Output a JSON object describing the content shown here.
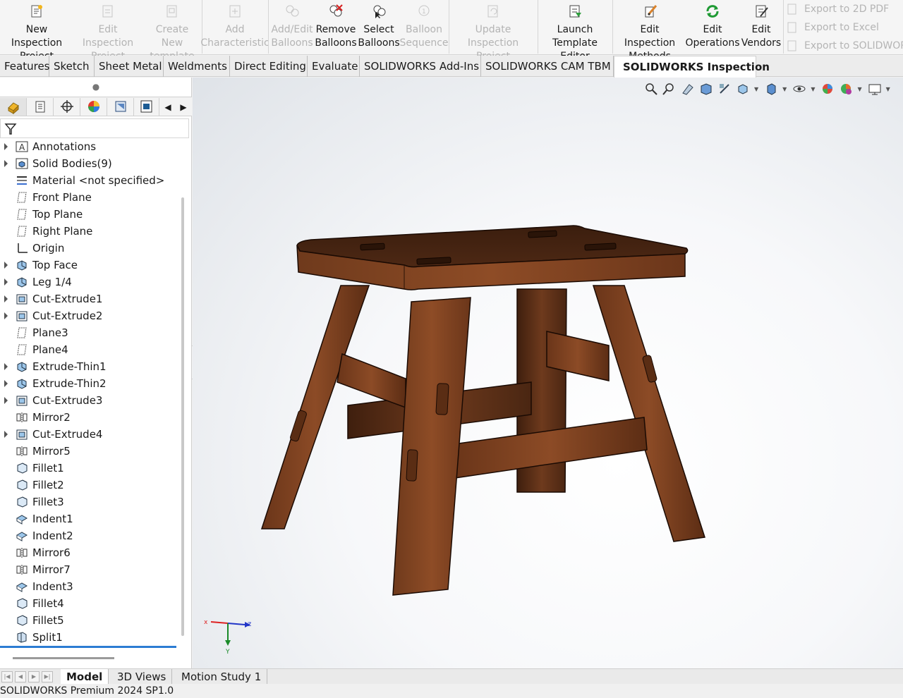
{
  "ribbon": {
    "buttons": [
      {
        "label": "New Inspection Project",
        "line1": "New Inspection",
        "line2": "Project",
        "icon": "new-inspection-project-icon",
        "enabled": true
      },
      {
        "label": "Edit Inspection Project",
        "line1": "Edit Inspection",
        "line2": "Project",
        "icon": "edit-inspection-project-icon",
        "enabled": false
      },
      {
        "label": "Create New template",
        "line1": "Create New",
        "line2": "template",
        "icon": "create-template-icon",
        "enabled": false
      },
      {
        "label": "Add Characteristic",
        "line1": "Add",
        "line2": "Characteristic",
        "icon": "add-characteristic-icon",
        "enabled": false
      },
      {
        "label": "Add/Edit Balloons",
        "line1": "Add/Edit",
        "line2": "Balloons",
        "icon": "add-edit-balloons-icon",
        "enabled": false
      },
      {
        "label": "Remove Balloons",
        "line1": "Remove",
        "line2": "Balloons",
        "icon": "remove-balloons-icon",
        "enabled": true
      },
      {
        "label": "Select Balloons",
        "line1": "Select",
        "line2": "Balloons",
        "icon": "select-balloons-icon",
        "enabled": true
      },
      {
        "label": "Balloon Sequence",
        "line1": "Balloon",
        "line2": "Sequence",
        "icon": "balloon-sequence-icon",
        "enabled": false
      },
      {
        "label": "Update Inspection Project",
        "line1": "Update Inspection",
        "line2": "Project",
        "icon": "update-inspection-icon",
        "enabled": false
      },
      {
        "label": "Launch Template Editor",
        "line1": "Launch",
        "line2": "Template Editor",
        "icon": "launch-template-editor-icon",
        "enabled": true
      },
      {
        "label": "Edit Inspection Methods",
        "line1": "Edit Inspection",
        "line2": "Methods",
        "icon": "edit-inspection-methods-icon",
        "enabled": true
      },
      {
        "label": "Edit Operations",
        "line1": "Edit",
        "line2": "Operations",
        "icon": "edit-operations-icon",
        "enabled": true
      },
      {
        "label": "Edit Vendors",
        "line1": "Edit",
        "line2": "Vendors",
        "icon": "edit-vendors-icon",
        "enabled": true
      }
    ],
    "exports": [
      {
        "label": "Export to 2D PDF",
        "icon": "export-pdf-icon"
      },
      {
        "label": "Export to Excel",
        "icon": "export-excel-icon"
      },
      {
        "label": "Export to SOLIDWORK",
        "icon": "export-solidworks-icon"
      }
    ]
  },
  "tabs": [
    "Features",
    "Sketch",
    "Sheet Metal",
    "Weldments",
    "Direct Editing",
    "Evaluate",
    "SOLIDWORKS Add-Ins",
    "SOLIDWORKS CAM TBM",
    "SOLIDWORKS Inspection"
  ],
  "active_tab": "SOLIDWORKS Inspection",
  "panel": {
    "pm_tabs": [
      "feature-manager-icon",
      "property-manager-icon",
      "configuration-manager-icon",
      "appearance-manager-icon",
      "dimxpert-icon",
      "cam-icon"
    ],
    "tree": [
      {
        "label": "Annotations",
        "icon": "annotations-icon",
        "expandable": true
      },
      {
        "label": "Solid Bodies(9)",
        "icon": "solid-bodies-icon",
        "expandable": true
      },
      {
        "label": "Material <not specified>",
        "icon": "material-icon",
        "expandable": false
      },
      {
        "label": "Front Plane",
        "icon": "plane-icon",
        "expandable": false
      },
      {
        "label": "Top Plane",
        "icon": "plane-icon",
        "expandable": false
      },
      {
        "label": "Right Plane",
        "icon": "plane-icon",
        "expandable": false
      },
      {
        "label": "Origin",
        "icon": "origin-icon",
        "expandable": false
      },
      {
        "label": "Top Face",
        "icon": "extrude-icon",
        "expandable": true
      },
      {
        "label": "Leg 1/4",
        "icon": "extrude-icon",
        "expandable": true
      },
      {
        "label": "Cut-Extrude1",
        "icon": "cut-extrude-icon",
        "expandable": true
      },
      {
        "label": "Cut-Extrude2",
        "icon": "cut-extrude-icon",
        "expandable": true
      },
      {
        "label": "Plane3",
        "icon": "plane-icon",
        "expandable": false
      },
      {
        "label": "Plane4",
        "icon": "plane-icon",
        "expandable": false
      },
      {
        "label": "Extrude-Thin1",
        "icon": "extrude-icon",
        "expandable": true
      },
      {
        "label": "Extrude-Thin2",
        "icon": "extrude-icon",
        "expandable": true
      },
      {
        "label": "Cut-Extrude3",
        "icon": "cut-extrude-icon",
        "expandable": true
      },
      {
        "label": "Mirror2",
        "icon": "mirror-icon",
        "expandable": false
      },
      {
        "label": "Cut-Extrude4",
        "icon": "cut-extrude-icon",
        "expandable": true
      },
      {
        "label": "Mirror5",
        "icon": "mirror-icon",
        "expandable": false
      },
      {
        "label": "Fillet1",
        "icon": "fillet-icon",
        "expandable": false
      },
      {
        "label": "Fillet2",
        "icon": "fillet-icon",
        "expandable": false
      },
      {
        "label": "Fillet3",
        "icon": "fillet-icon",
        "expandable": false
      },
      {
        "label": "Indent1",
        "icon": "indent-icon",
        "expandable": false
      },
      {
        "label": "Indent2",
        "icon": "indent-icon",
        "expandable": false
      },
      {
        "label": "Mirror6",
        "icon": "mirror-icon",
        "expandable": false
      },
      {
        "label": "Mirror7",
        "icon": "mirror-icon",
        "expandable": false
      },
      {
        "label": "Indent3",
        "icon": "indent-icon",
        "expandable": false
      },
      {
        "label": "Fillet4",
        "icon": "fillet-icon",
        "expandable": false
      },
      {
        "label": "Fillet5",
        "icon": "fillet-icon",
        "expandable": false
      },
      {
        "label": "Split1",
        "icon": "split-icon",
        "expandable": false
      }
    ]
  },
  "viewport": {
    "heads_up_icons": [
      "zoom-to-fit-icon",
      "zoom-to-area-icon",
      "previous-view-icon",
      "section-view-icon",
      "dynamic-annotation-icon",
      "view-orientation-icon",
      "display-style-icon",
      "hide-show-icon",
      "edit-appearance-icon",
      "apply-scene-icon",
      "view-settings-icon"
    ],
    "model": "wooden-stool",
    "triad": {
      "x": "x",
      "y": "Y",
      "z": "z"
    }
  },
  "bottom_tabs": [
    "Model",
    "3D Views",
    "Motion Study 1"
  ],
  "active_bottom_tab": "Model",
  "status": "SOLIDWORKS Premium 2024 SP1.0",
  "colors": {
    "accent": "#2b7cd3",
    "wood": "#5a2e17",
    "wood_light": "#8a4a28"
  }
}
